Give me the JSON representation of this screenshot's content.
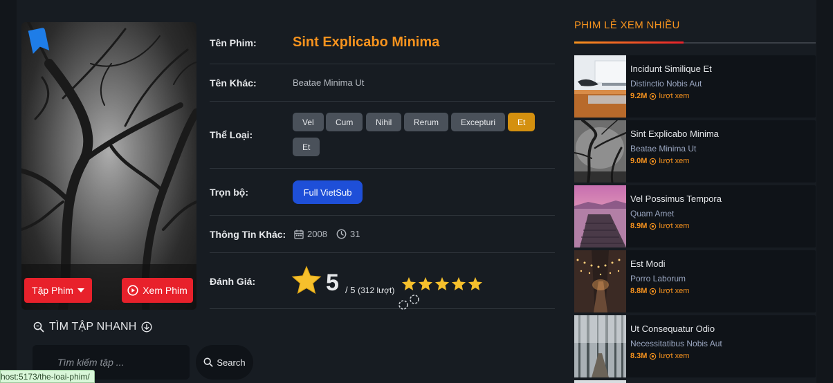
{
  "poster": {
    "episodes_button": "Tập Phim",
    "watch_button": "Xem Phim"
  },
  "quick_find": {
    "title": "TÌM TẬP NHANH",
    "placeholder": "Tìm kiếm tập ...",
    "search_button": "Search"
  },
  "info": {
    "name_label": "Tên Phim:",
    "name_value": "Sint Explicabo Minima",
    "alt_label": "Tên Khác:",
    "alt_value": "Beatae Minima Ut",
    "genre_label": "Thể Loại:",
    "genres": [
      "Vel",
      "Cum",
      "Nihil",
      "Rerum",
      "Excepturi",
      "Et",
      "Et"
    ],
    "active_genre_index": 5,
    "status_label": "Trọn bộ:",
    "status_value": "Full VietSub",
    "other_label": "Thông Tin Khác:",
    "year": "2008",
    "duration": "31",
    "rating_label": "Đánh Giá:",
    "rating_value": "5",
    "rating_max": "/ 5",
    "rating_count": "(312 lượt)",
    "rating_stars": 5
  },
  "sidebar": {
    "title": "PHIM LẺ XEM NHIỀU",
    "items": [
      {
        "name": "Incidunt Similique Et",
        "alt": "Distinctio Nobis Aut",
        "views": "9.2M",
        "unit": "lượt xem"
      },
      {
        "name": "Sint Explicabo Minima",
        "alt": "Beatae Minima Ut",
        "views": "9.0M",
        "unit": "lượt xem"
      },
      {
        "name": "Vel Possimus Tempora",
        "alt": "Quam Amet",
        "views": "8.9M",
        "unit": "lượt xem"
      },
      {
        "name": "Est Modi",
        "alt": "Porro Laborum",
        "views": "8.8M",
        "unit": "lượt xem"
      },
      {
        "name": "Ut Consequatur Odio",
        "alt": "Necessitatibus Nobis Aut",
        "views": "8.3M",
        "unit": "lượt xem"
      }
    ]
  },
  "status_url": "host:5173/the-loai-phim/",
  "colors": {
    "accent": "#f7931e",
    "primary_button": "#e8212b",
    "badge_blue": "#1e4fd8",
    "active_tag": "#d4900f"
  }
}
